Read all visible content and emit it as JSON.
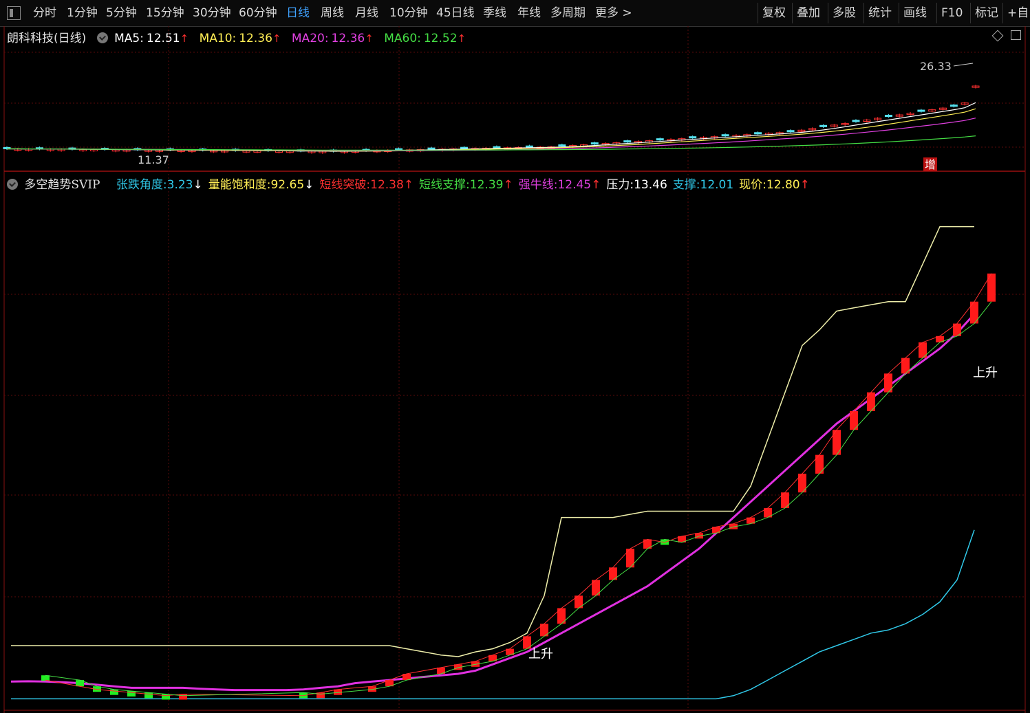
{
  "toolbar": {
    "left_items": [
      {
        "label": "分时",
        "active": false
      },
      {
        "label": "1分钟",
        "active": false
      },
      {
        "label": "5分钟",
        "active": false
      },
      {
        "label": "15分钟",
        "active": false
      },
      {
        "label": "30分钟",
        "active": false
      },
      {
        "label": "60分钟",
        "active": false
      },
      {
        "label": "日线",
        "active": true
      },
      {
        "label": "周线",
        "active": false
      },
      {
        "label": "月线",
        "active": false
      },
      {
        "label": "10分钟",
        "active": false
      },
      {
        "label": "45日线",
        "active": false
      },
      {
        "label": "季线",
        "active": false
      },
      {
        "label": "年线",
        "active": false
      },
      {
        "label": "多周期",
        "active": false
      },
      {
        "label": "更多 >",
        "active": false
      }
    ],
    "right_items": [
      "复权",
      "叠加",
      "多股",
      "统计",
      "画线",
      "F10",
      "标记",
      "+自"
    ]
  },
  "main_legend": {
    "title": "朗科科技(日线)",
    "ma5": {
      "label": "MA5:",
      "value": "12.51",
      "color": "#ffffff"
    },
    "ma10": {
      "label": "MA10:",
      "value": "12.36",
      "color": "#ffee55"
    },
    "ma20": {
      "label": "MA20:",
      "value": "12.36",
      "color": "#e040e0"
    },
    "ma60": {
      "label": "MA60:",
      "value": "12.52",
      "color": "#44dd44"
    },
    "up_arrow": "↑",
    "down_arrow": "↓"
  },
  "main_chart": {
    "high_label": "26.33",
    "low_label": "11.37",
    "badge": "增"
  },
  "indicator_legend": {
    "name": "多空趋势SVIP",
    "items": [
      {
        "label": "张跌角度:",
        "value": "3.23",
        "arrow": "↓",
        "color": "#30c8e8"
      },
      {
        "label": "量能饱和度:",
        "value": "92.65",
        "arrow": "↓",
        "color": "#ffee55"
      },
      {
        "label": "短线突破:",
        "value": "12.38",
        "arrow": "↑",
        "color": "#ff3030"
      },
      {
        "label": "短线支撑:",
        "value": "12.39",
        "arrow": "↑",
        "color": "#44dd44"
      },
      {
        "label": "强牛线:",
        "value": "12.45",
        "arrow": "↑",
        "color": "#e040e0"
      },
      {
        "label": "压力:",
        "value": "13.46",
        "arrow": "",
        "color": "#ffffff"
      },
      {
        "label": "支撑:",
        "value": "12.01",
        "arrow": "",
        "color": "#30c8e8"
      },
      {
        "label": "现价:",
        "value": "12.80",
        "arrow": "↑",
        "color": "#ffee55"
      }
    ]
  },
  "indicator_chart": {
    "rise_label_1": "上升",
    "rise_label_2": "上升"
  },
  "chart_data": {
    "type": "candlestick",
    "title": "朗科科技(日线)",
    "price_range": [
      11.37,
      26.33
    ],
    "moving_averages": {
      "MA5": 12.51,
      "MA10": 12.36,
      "MA20": 12.36,
      "MA60": 12.52
    },
    "trend_candles": {
      "colors": {
        "up": "#ff1a1a",
        "down": "#22ee22"
      },
      "open": [
        11.95,
        11.8,
        11.6,
        11.5,
        11.45,
        11.4,
        11.35,
        11.3,
        11.4,
        11.35,
        11.4,
        11.5,
        11.6,
        11.8,
        12.0,
        12.2,
        12.3,
        12.4,
        12.6,
        12.8,
        13.2,
        13.6,
        14.1,
        14.5,
        15.0,
        15.4,
        16.0,
        16.3,
        16.2,
        16.4,
        16.5,
        16.7,
        16.8,
        17.0,
        17.3,
        17.8,
        18.4,
        19.0,
        19.8,
        20.4,
        21.0,
        21.6,
        22.1,
        22.6,
        22.8,
        23.2,
        23.9
      ],
      "close": [
        11.8,
        11.6,
        11.5,
        11.45,
        11.4,
        11.35,
        11.3,
        11.35,
        11.3,
        11.4,
        11.5,
        11.6,
        11.8,
        12.0,
        12.2,
        12.3,
        12.4,
        12.6,
        12.8,
        13.2,
        13.6,
        14.1,
        14.5,
        15.0,
        15.4,
        16.0,
        16.3,
        16.2,
        16.4,
        16.5,
        16.7,
        16.8,
        17.0,
        17.3,
        17.8,
        18.4,
        19.0,
        19.8,
        20.4,
        21.0,
        21.6,
        22.1,
        22.6,
        22.8,
        23.2,
        23.9,
        24.8
      ],
      "candle_index": [
        2,
        4,
        5,
        6,
        7,
        8,
        9,
        10,
        17,
        18,
        19,
        21,
        22,
        23,
        25,
        26,
        27,
        28,
        29,
        30,
        31,
        32,
        33,
        34,
        35,
        36,
        37,
        38,
        39,
        40,
        41,
        42,
        43,
        44,
        45,
        46,
        47,
        48,
        49,
        50,
        51,
        52,
        53,
        54,
        55,
        56,
        57
      ]
    },
    "lines": {
      "pressure": {
        "color": "#eeeeaa",
        "values": [
          12.9,
          12.9,
          12.9,
          12.9,
          12.9,
          12.9,
          12.9,
          12.9,
          12.9,
          12.9,
          12.9,
          12.9,
          12.9,
          12.9,
          12.9,
          12.9,
          12.9,
          12.9,
          12.9,
          12.9,
          12.9,
          12.9,
          12.9,
          12.8,
          12.7,
          12.6,
          12.55,
          12.7,
          12.8,
          13.0,
          13.3,
          14.5,
          17.0,
          17.0,
          17.0,
          17.0,
          17.1,
          17.2,
          17.2,
          17.2,
          17.2,
          17.2,
          17.2,
          18.0,
          19.5,
          21.0,
          22.5,
          23.0,
          23.6,
          23.7,
          23.8,
          23.9,
          23.9,
          25.1,
          26.3,
          26.3,
          26.3
        ]
      },
      "strong_bull": {
        "color": "#e030e0",
        "values": [
          11.75,
          11.76,
          11.75,
          11.73,
          11.7,
          11.65,
          11.6,
          11.55,
          11.55,
          11.55,
          11.55,
          11.52,
          11.5,
          11.48,
          11.48,
          11.48,
          11.48,
          11.5,
          11.55,
          11.6,
          11.7,
          11.75,
          11.8,
          11.85,
          11.9,
          11.95,
          12.0,
          12.1,
          12.3,
          12.5,
          12.7,
          13.0,
          13.3,
          13.6,
          13.9,
          14.2,
          14.5,
          14.8,
          15.2,
          15.6,
          16.0,
          16.5,
          17.0,
          17.5,
          18.0,
          18.5,
          19.0,
          19.5,
          20.0,
          20.4,
          20.8,
          21.2,
          21.6,
          22.0,
          22.4,
          22.9,
          23.5
        ]
      },
      "support": {
        "color": "#30c8e8",
        "values": [
          11.2,
          11.2,
          11.2,
          11.2,
          11.2,
          11.2,
          11.2,
          11.2,
          11.2,
          11.2,
          11.2,
          11.2,
          11.2,
          11.2,
          11.2,
          11.2,
          11.2,
          11.2,
          11.2,
          11.2,
          11.2,
          11.2,
          11.2,
          11.2,
          11.2,
          11.2,
          11.2,
          11.2,
          11.2,
          11.2,
          11.2,
          11.2,
          11.2,
          11.2,
          11.2,
          11.2,
          11.2,
          11.2,
          11.2,
          11.2,
          11.2,
          11.2,
          11.3,
          11.5,
          11.8,
          12.1,
          12.4,
          12.7,
          12.9,
          13.1,
          13.3,
          13.4,
          13.6,
          13.9,
          14.3,
          15.0,
          16.6
        ]
      }
    }
  }
}
